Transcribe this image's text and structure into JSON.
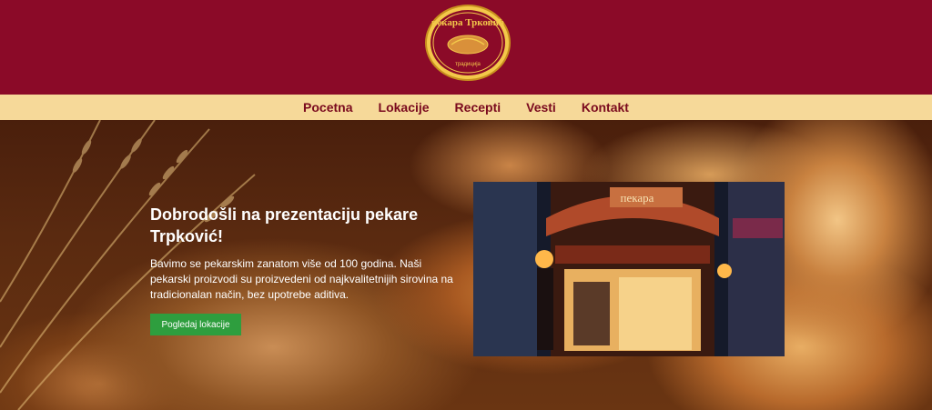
{
  "brand": {
    "logo_text": "пекара Трковић",
    "logo_subtext": "традиција",
    "colors": {
      "header": "#8b0a28",
      "nav": "#f6d999",
      "nav_text": "#7a0a1e",
      "button": "#2e9e3e"
    }
  },
  "nav": {
    "items": [
      {
        "label": "Pocetna"
      },
      {
        "label": "Lokacije"
      },
      {
        "label": "Recepti"
      },
      {
        "label": "Vesti"
      },
      {
        "label": "Kontakt"
      }
    ]
  },
  "hero": {
    "title": "Dobrodošli na prezentaciju pekare Trpković!",
    "text": "Bavimo se pekarskim zanatom više od 100 godina. Naši pekarski proizvodi su proizvedeni od najkvalitetnijih sirovina na tradicionalan način, bez upotrebe aditiva.",
    "button_label": "Pogledaj lokacije",
    "photo_sign": "пекара"
  }
}
